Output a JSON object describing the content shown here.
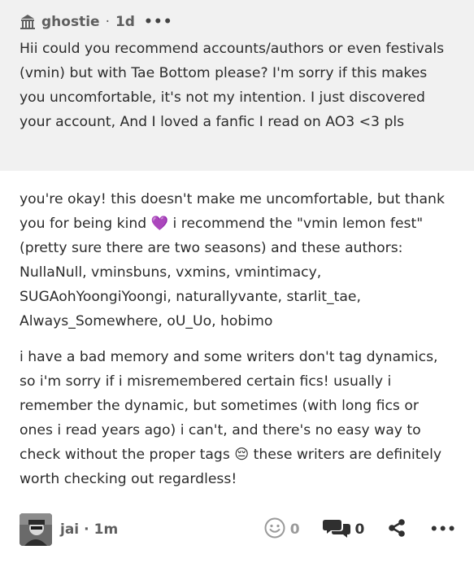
{
  "question": {
    "asker_name": "ghostie",
    "separator": "·",
    "time": "1d",
    "more_label": "•••",
    "text": "Hii could you recommend accounts/authors or even festivals (vmin) but with Tae Bottom please? I'm sorry if this makes you uncomfortable, it's not my intention. I just discovered your account, And I loved a fanfic I read on AO3 <3 pls",
    "asker_icon": "anonymous-building-icon"
  },
  "answer": {
    "paragraph1_before": "you're okay! this doesn't make me uncomfortable, but thank you for being kind",
    "heart": "💜",
    "paragraph1_after": "i recommend the \"vmin lemon fest\" (pretty sure there are two seasons) and these authors: NullaNull, vminsbuns, vxmins, vmintimacy, SUGAohYoongiYoongi, naturallyvante, starlit_tae, Always_Somewhere, oU_Uo, hobimo",
    "paragraph2_before": "i have a bad memory and some writers don't tag dynamics, so i'm sorry if i misremembered certain fics! usually i remember the dynamic, but sometimes (with long fics or ones i read years ago) i can't, and there's no easy way to check without the proper tags",
    "pensive": "😔",
    "paragraph2_after": "these writers are definitely worth checking out regardless!"
  },
  "footer": {
    "author_name": "jai",
    "separator": "·",
    "time": "1m",
    "reactions_count": "0",
    "comments_count": "0",
    "more_label": "•••"
  },
  "colors": {
    "question_bg": "#f1f1f1",
    "text": "#2b2b2b",
    "meta": "#5f5f5f",
    "heart": "#9b3fd9"
  }
}
